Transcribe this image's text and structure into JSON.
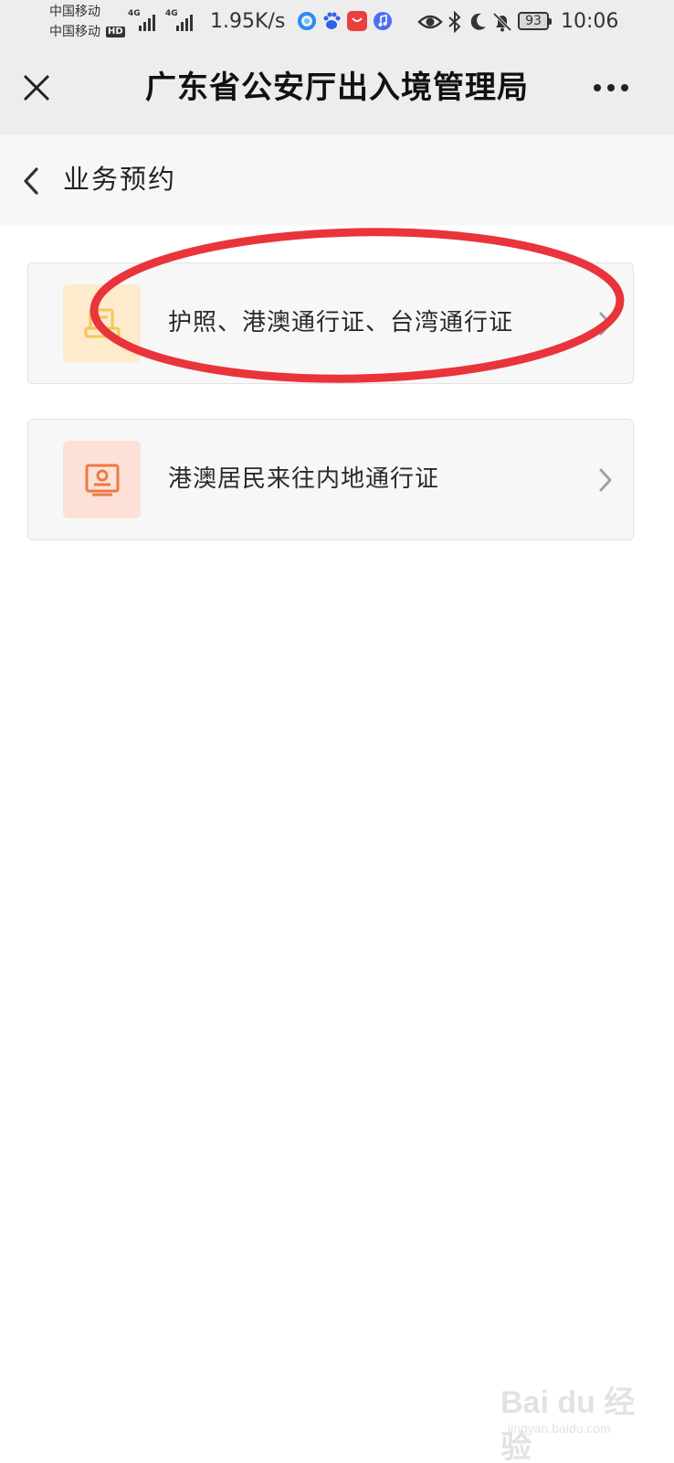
{
  "status_bar": {
    "carrier_1": "中国移动",
    "carrier_2": "中国移动",
    "hd_label": "HD",
    "signal_1_tag": "4G",
    "signal_2_tag": "4G",
    "net_speed": "1.95K/s",
    "battery": "93",
    "time": "10:06",
    "app_icons": [
      "qq-browser-icon",
      "baidu-icon",
      "huawei-store-icon",
      "music-icon"
    ],
    "system_icons": [
      "eye-icon",
      "bluetooth-icon",
      "moon-icon",
      "bell-off-icon"
    ]
  },
  "app_bar": {
    "title": "广东省公安厅出入境管理局",
    "close_icon": "close-icon",
    "more_icon": "more-icon"
  },
  "page_nav": {
    "back_icon": "chevron-left-icon",
    "title": "业务预约"
  },
  "services": [
    {
      "label": "护照、港澳通行证、台湾通行证",
      "icon": "passport-icon",
      "icon_color": "#f5c65a",
      "icon_bg": "#fdebcc"
    },
    {
      "label": "港澳居民来往内地通行证",
      "icon": "id-card-icon",
      "icon_color": "#ec7a45",
      "icon_bg": "#fde1d6"
    }
  ],
  "annotation": {
    "type": "red-ellipse",
    "color": "#e8343a",
    "target": "services.0"
  },
  "watermark": {
    "logo": "Bai du 经验",
    "sub": "jingyan.baidu.com"
  },
  "colors": {
    "top_bar_bg": "#ededed",
    "nav_bg": "#f7f7f7",
    "card_bg": "#f7f7f7",
    "chevron": "#9aa3b0"
  }
}
